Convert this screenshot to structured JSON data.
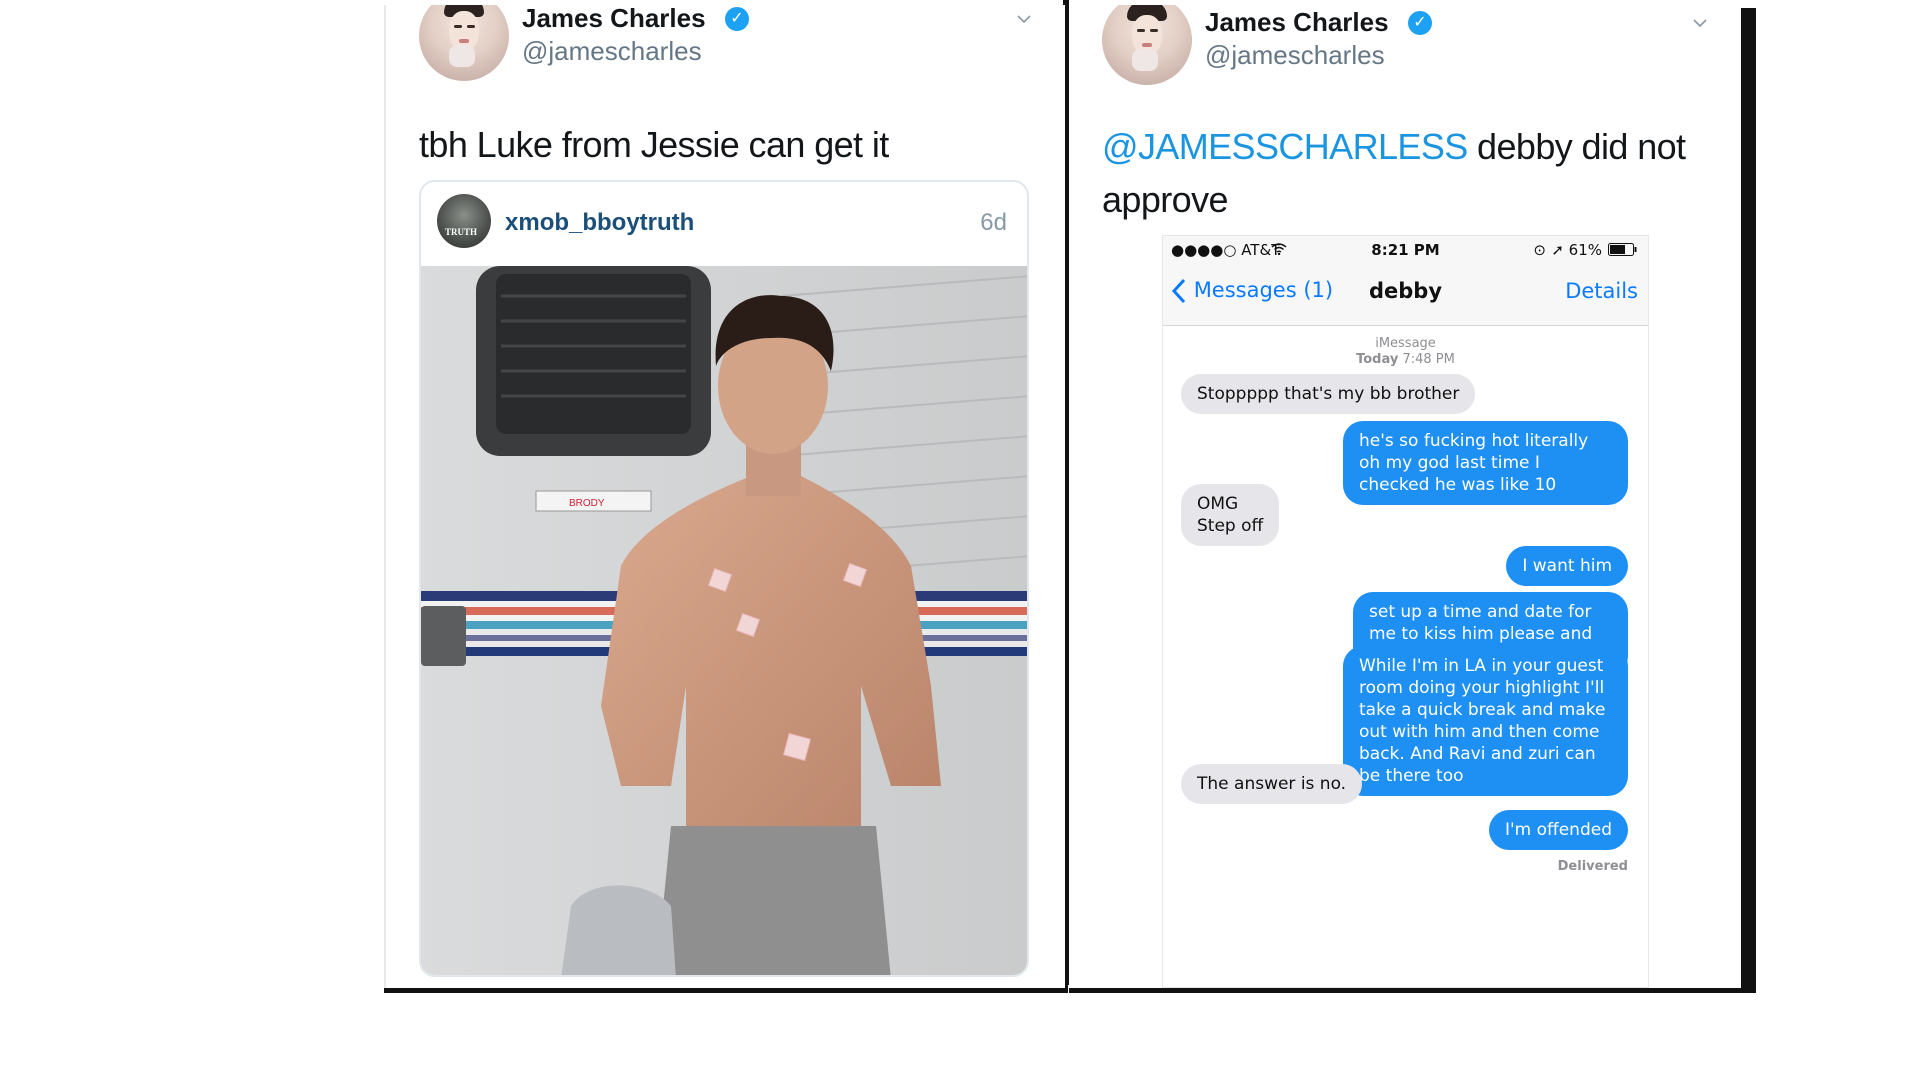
{
  "left_tweet": {
    "display_name": "James Charles",
    "handle": "@jamescharles",
    "text": "tbh Luke from Jessie can get it",
    "quote": {
      "avatar_label": "TRUTH",
      "username": "xmob_bboytruth",
      "time": "6d",
      "photo_label": "BRODY"
    }
  },
  "right_tweet": {
    "display_name": "James Charles",
    "handle": "@jamescharles",
    "mention": "@JAMESSCHARLESS",
    "text_line1_rest": " debby did not",
    "text_line2": "approve",
    "screenshot": {
      "carrier": "●●●●○ AT&T",
      "time": "8:21 PM",
      "battery": "61%",
      "back_label": "Messages (1)",
      "contact": "debby",
      "details_label": "Details",
      "service": "iMessage",
      "date_prefix": "Today",
      "date_time": "7:48 PM",
      "messages": [
        {
          "dir": "in",
          "text": "Stoppppp that's my bb brother"
        },
        {
          "dir": "out",
          "text": "he's so fucking hot literally oh my god last time I checked he was like 10"
        },
        {
          "dir": "in",
          "text": "OMG\nStep off"
        },
        {
          "dir": "out",
          "text": "I want him"
        },
        {
          "dir": "out",
          "text": "set up a time and date for me to kiss him please and thank you xo"
        },
        {
          "dir": "out",
          "text": "While I'm in LA in your guest room doing your highlight I'll take a quick break and make out with him and then come back. And Ravi and zuri can be there too"
        },
        {
          "dir": "in",
          "text": "The answer is no."
        },
        {
          "dir": "out",
          "text": "I'm offended"
        }
      ],
      "delivered": "Delivered"
    }
  },
  "colors": {
    "link_blue": "#1b95e0",
    "verified_blue": "#1da1f2",
    "imessage_blue": "#1e8ff3",
    "received_gray": "#e5e5ea"
  }
}
